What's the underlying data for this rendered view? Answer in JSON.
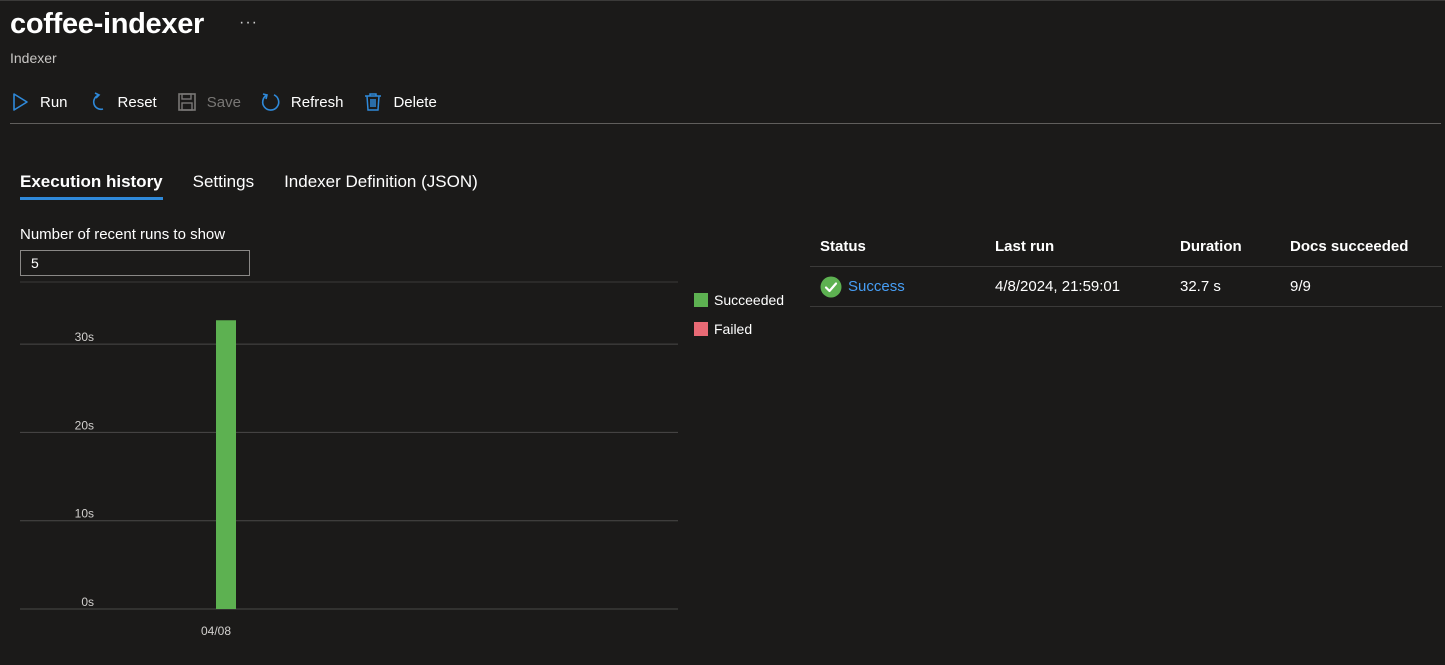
{
  "header": {
    "title": "coffee-indexer",
    "subtitle": "Indexer",
    "more": "···"
  },
  "toolbar": {
    "run": "Run",
    "reset": "Reset",
    "save": "Save",
    "refresh": "Refresh",
    "delete": "Delete"
  },
  "tabs": [
    {
      "label": "Execution history",
      "active": true
    },
    {
      "label": "Settings",
      "active": false
    },
    {
      "label": "Indexer Definition (JSON)",
      "active": false
    }
  ],
  "runs": {
    "label": "Number of recent runs to show",
    "value": "5"
  },
  "legend": {
    "succeeded": "Succeeded",
    "failed": "Failed"
  },
  "colors": {
    "succeeded": "#5db151",
    "failed": "#e86a75",
    "accent": "#2f89d9",
    "link": "#479ef5"
  },
  "chart_data": {
    "type": "bar",
    "categories": [
      "04/08"
    ],
    "series": [
      {
        "name": "Succeeded",
        "values": [
          32.7
        ]
      },
      {
        "name": "Failed",
        "values": [
          0
        ]
      }
    ],
    "yticks": [
      "0s",
      "10s",
      "20s",
      "30s"
    ],
    "ylim": [
      0,
      35
    ],
    "grid": true,
    "legend": "right"
  },
  "table": {
    "headers": [
      "Status",
      "Last run",
      "Duration",
      "Docs succeeded"
    ],
    "rows": [
      {
        "status": "Success",
        "last_run": "4/8/2024, 21:59:01",
        "duration": "32.7 s",
        "docs": "9/9"
      }
    ]
  }
}
